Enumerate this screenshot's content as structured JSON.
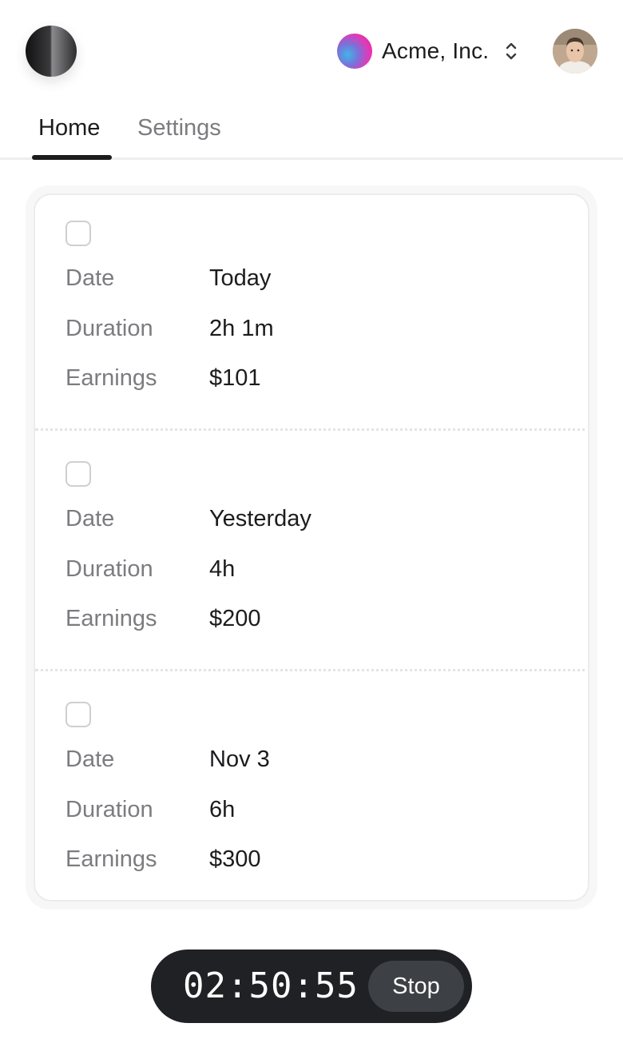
{
  "header": {
    "org_name": "Acme, Inc."
  },
  "tabs": [
    {
      "label": "Home",
      "active": true
    },
    {
      "label": "Settings",
      "active": false
    }
  ],
  "entries": [
    {
      "checked": false,
      "date_label": "Date",
      "date": "Today",
      "duration_label": "Duration",
      "duration": "2h 1m",
      "earnings_label": "Earnings",
      "earnings": "$101"
    },
    {
      "checked": false,
      "date_label": "Date",
      "date": "Yesterday",
      "duration_label": "Duration",
      "duration": "4h",
      "earnings_label": "Earnings",
      "earnings": "$200"
    },
    {
      "checked": false,
      "date_label": "Date",
      "date": "Nov 3",
      "duration_label": "Duration",
      "duration": "6h",
      "earnings_label": "Earnings",
      "earnings": "$300"
    }
  ],
  "timer": {
    "time": "02:50:55",
    "stop_label": "Stop"
  },
  "icons": {
    "logo": "app-logo-icon",
    "org": "org-gradient-icon",
    "chevron": "chevron-up-down-icon",
    "avatar": "user-avatar"
  },
  "colors": {
    "background": "#ffffff",
    "text": "#1c1c1e",
    "muted": "#7c7c80",
    "timer_bg": "#1f2124",
    "stop_bg": "#3d4044"
  }
}
